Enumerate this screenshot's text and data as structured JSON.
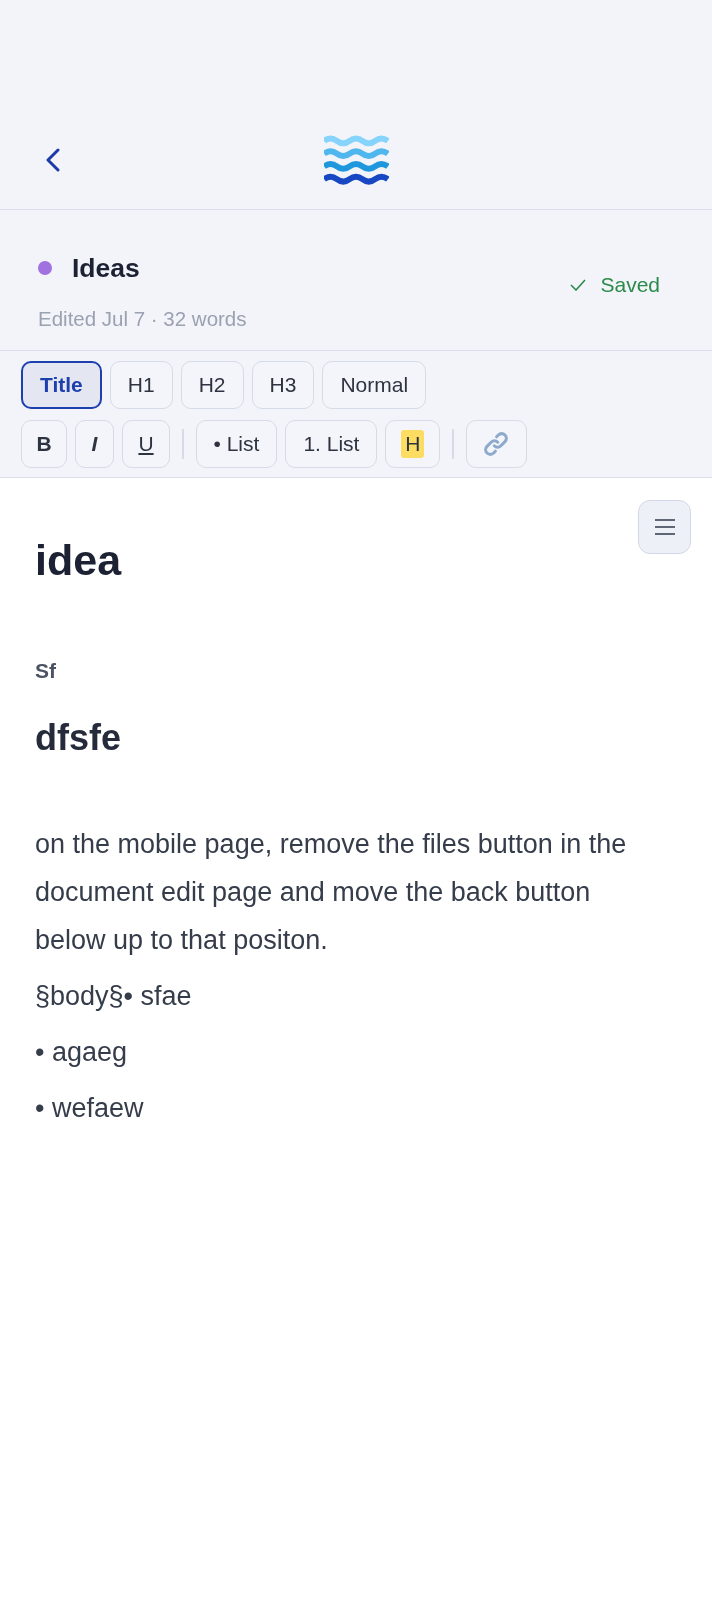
{
  "note": {
    "title": "Ideas",
    "meta": "Edited Jul 7 · 32 words",
    "status": "Saved"
  },
  "toolbar": {
    "block_styles": [
      {
        "label": "Title",
        "selected": true
      },
      {
        "label": "H1",
        "selected": false
      },
      {
        "label": "H2",
        "selected": false
      },
      {
        "label": "H3",
        "selected": false
      },
      {
        "label": "Normal",
        "selected": false
      }
    ],
    "format_groups": [
      [
        {
          "kind": "bold",
          "label": "B"
        },
        {
          "kind": "italic",
          "label": "I"
        },
        {
          "kind": "underline",
          "label": "U"
        }
      ],
      [
        {
          "kind": "bullet",
          "label": "• List"
        },
        {
          "kind": "numbered",
          "label": "1. List"
        },
        {
          "kind": "highlight",
          "label": "H"
        }
      ],
      [
        {
          "kind": "link"
        }
      ]
    ]
  },
  "content": [
    {
      "kind": "title",
      "text": "idea"
    },
    {
      "kind": "small",
      "text": "Sf"
    },
    {
      "kind": "heading",
      "text": "dfsfe"
    },
    {
      "kind": "paragraph",
      "text": "on the mobile page, remove the files button in the document edit page and move the back button below up to that positon."
    },
    {
      "kind": "line",
      "text": "§body§• sfae"
    },
    {
      "kind": "line",
      "text": "• agaeg"
    },
    {
      "kind": "line",
      "text": "• wefaew"
    }
  ]
}
